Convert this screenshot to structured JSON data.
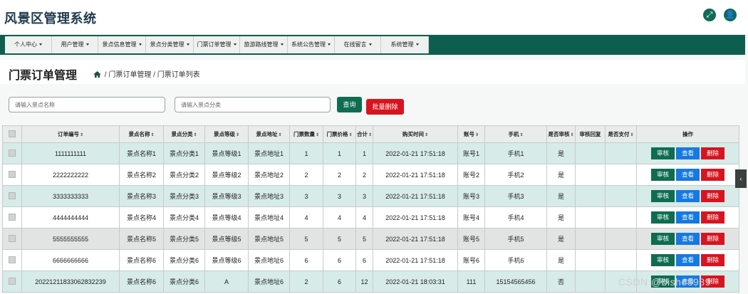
{
  "app": {
    "title": "风景区管理系统"
  },
  "nav": {
    "items": [
      {
        "label": "个人中心"
      },
      {
        "label": "用户管理"
      },
      {
        "label": "景点信息管理"
      },
      {
        "label": "景点分类管理"
      },
      {
        "label": "门票订单管理"
      },
      {
        "label": "旅游路线管理"
      },
      {
        "label": "系统公告管理"
      },
      {
        "label": "在线留言"
      },
      {
        "label": "系统管理"
      }
    ]
  },
  "page": {
    "title": "门票订单管理",
    "breadcrumb_1": "门票订单管理",
    "breadcrumb_2": "门票订单列表",
    "breadcrumb_sep": "/"
  },
  "search": {
    "name_placeholder": "请输入景点名称",
    "category_placeholder": "请输入景点分类",
    "query_label": "查询",
    "batch_delete_label": "批量删除"
  },
  "table": {
    "headers": [
      "订单编号",
      "景点名称",
      "景点分类",
      "景点等级",
      "景点地址",
      "门票数量",
      "门票价格",
      "合计",
      "购买时间",
      "账号",
      "手机",
      "是否审核",
      "审核回复",
      "是否支付",
      "操作"
    ],
    "actions": {
      "review": "审核",
      "view": "查看",
      "delete": "删除"
    },
    "rows": [
      [
        "1111111111",
        "景点名称1",
        "景点分类1",
        "景点等级1",
        "景点地址1",
        "1",
        "1",
        "1",
        "2022-01-21 17:51:18",
        "账号1",
        "手机1",
        "是",
        "",
        ""
      ],
      [
        "2222222222",
        "景点名称2",
        "景点分类2",
        "景点等级2",
        "景点地址2",
        "2",
        "2",
        "2",
        "2022-01-21 17:51:18",
        "账号2",
        "手机2",
        "是",
        "",
        ""
      ],
      [
        "3333333333",
        "景点名称3",
        "景点分类3",
        "景点等级3",
        "景点地址3",
        "3",
        "3",
        "3",
        "2022-01-21 17:51:18",
        "账号3",
        "手机3",
        "是",
        "",
        ""
      ],
      [
        "4444444444",
        "景点名称4",
        "景点分类4",
        "景点等级4",
        "景点地址4",
        "4",
        "4",
        "4",
        "2022-01-21 17:51:18",
        "账号4",
        "手机4",
        "是",
        "",
        ""
      ],
      [
        "5555555555",
        "景点名称5",
        "景点分类5",
        "景点等级5",
        "景点地址5",
        "5",
        "5",
        "5",
        "2022-01-21 17:51:18",
        "账号5",
        "手机5",
        "是",
        "",
        ""
      ],
      [
        "6666666666",
        "景点名称6",
        "景点分类6",
        "景点等级6",
        "景点地址6",
        "6",
        "6",
        "6",
        "2022-01-21 17:51:18",
        "账号6",
        "手机6",
        "是",
        "",
        ""
      ],
      [
        "20221211833062832239",
        "景点名称6",
        "景点分类6",
        "A",
        "景点地址6",
        "2",
        "6",
        "12",
        "2022-01-21 18:03:31",
        "111",
        "15154565456",
        "否",
        "",
        ""
      ]
    ]
  },
  "watermark": "CSDN @bishe8989",
  "colors": {
    "primary": "#0e6d50",
    "view": "#1679e0",
    "danger": "#d7141f",
    "nav_bg": "#0e5e4f"
  }
}
